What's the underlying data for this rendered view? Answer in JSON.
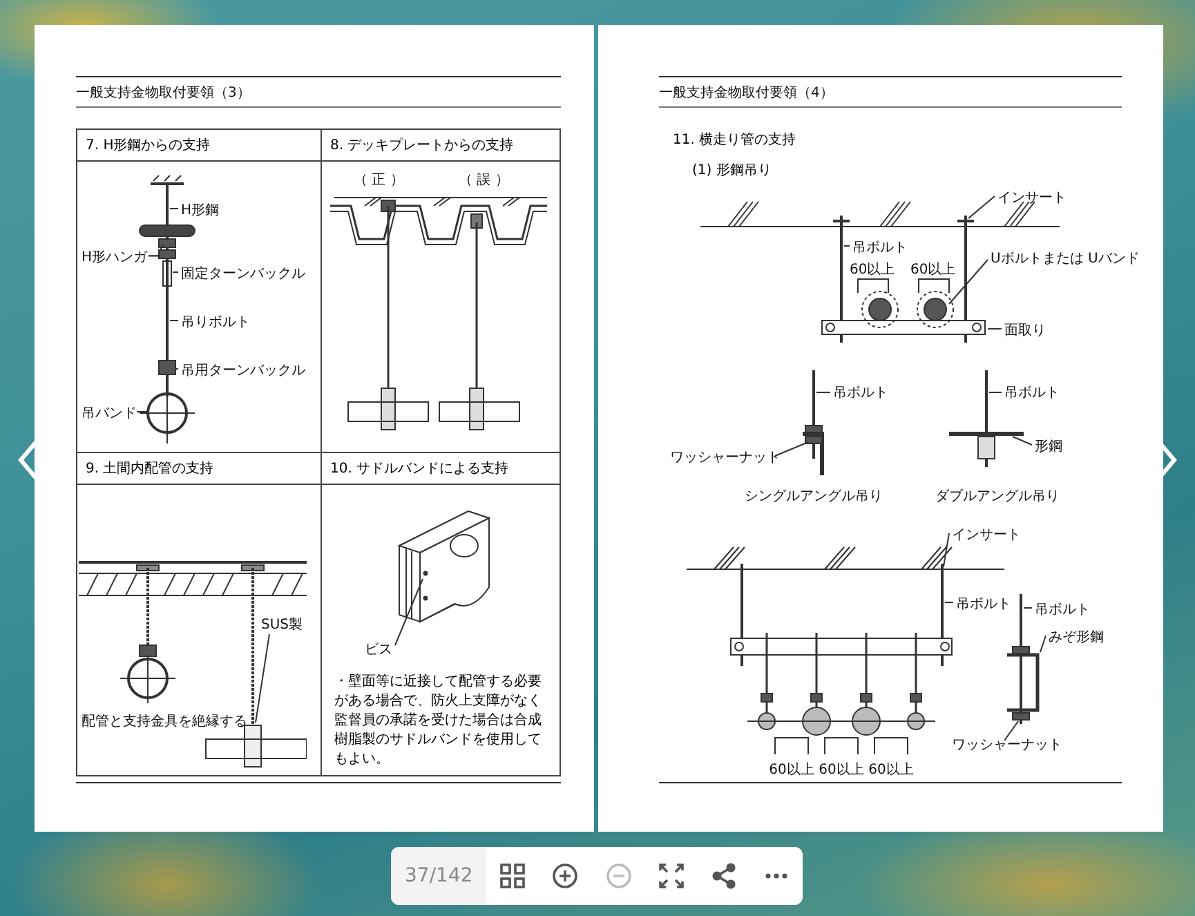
{
  "left_page": {
    "title": "一般支持金物取付要領（3）",
    "sections": [
      {
        "kind": "h-beam",
        "title": "7. H形鋼からの支持",
        "labels": [
          "H形鋼",
          "H形ハンガー",
          "固定ターンバックル",
          "吊りボルト",
          "吊用ターンバックル",
          "吊バンド"
        ]
      },
      {
        "kind": "deck-plate",
        "title": "8. デッキプレートからの支持",
        "labels": [
          "（ 正 ）",
          "（ 誤 ）"
        ]
      },
      {
        "kind": "slab-pipe",
        "title": "9. 土間内配管の支持",
        "labels": [
          "SUS製",
          "配管と支持金具を絶縁する"
        ]
      },
      {
        "kind": "saddle-band",
        "title": "10. サドルバンドによる支持",
        "labels": [
          "ビス"
        ],
        "note": "・壁面等に近接して配管する必要がある場合で、防火上支障がなく監督員の承諾を受けた場合は合成樹脂製のサドルバンドを使用してもよい。"
      }
    ]
  },
  "right_page": {
    "title": "一般支持金物取付要領（4）",
    "section_title": "11. 横走り管の支持",
    "subsection": "(1) 形鋼吊り",
    "labels": [
      "インサート",
      "吊ボルト",
      "Uボルトまたは Uバンド",
      "60以上",
      "60以上",
      "面取り",
      "吊ボルト",
      "ワッシャーナット",
      "吊ボルト",
      "形鋼",
      "シングルアングル吊り",
      "ダブルアングル吊り",
      "インサート",
      "吊ボルト",
      "吊ボルト",
      "みぞ形鋼",
      "ワッシャーナット",
      "60以上",
      "60以上",
      "60以上"
    ]
  },
  "toolbar": {
    "page_indicator": "37/142",
    "buttons": [
      {
        "kind": "grid",
        "disabled": false
      },
      {
        "kind": "zoom-in",
        "disabled": false
      },
      {
        "kind": "zoom-out",
        "disabled": true
      },
      {
        "kind": "fullscreen",
        "disabled": false
      },
      {
        "kind": "share",
        "disabled": false
      },
      {
        "kind": "more",
        "disabled": false
      }
    ]
  }
}
